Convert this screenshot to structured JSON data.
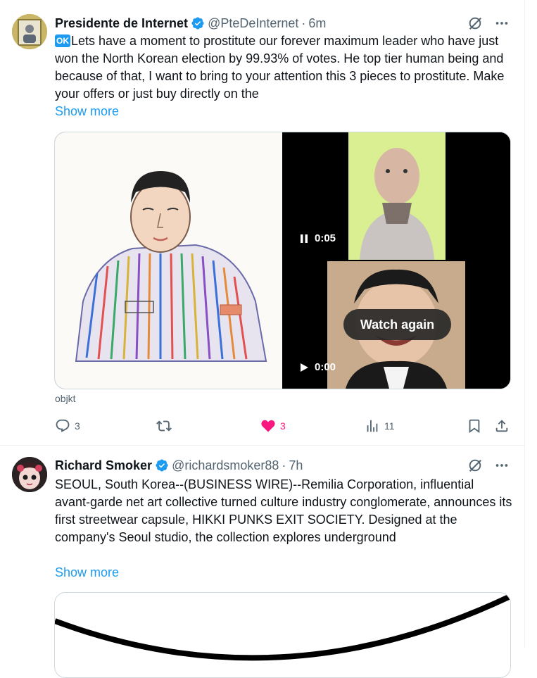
{
  "tweets": [
    {
      "display_name": "Presidente de Internet",
      "handle": "@PteDeInternet",
      "time": "6m",
      "ok_badge": "OK",
      "text": "Lets have a moment to prostitute our forever maximum leader who have just won the North Korean election by 99.93% of votes. He top tier human being and because of that, I want to bring to your attention this 3 pieces to prostitute. Make your offers or just buy directly on the",
      "show_more": "Show more",
      "media": {
        "video1_time": "0:05",
        "video2_time": "0:00",
        "watch_again": "Watch again"
      },
      "source": "objkt",
      "replies": "3",
      "likes": "3",
      "views": "11",
      "liked": true
    },
    {
      "display_name": "Richard Smoker",
      "handle": "@richardsmoker88",
      "time": "7h",
      "text": "SEOUL, South Korea--(BUSINESS WIRE)--Remilia Corporation, influential avant-garde net art collective turned culture industry conglomerate, announces its first streetwear capsule, HIKKI PUNKS EXIT SOCIETY. Designed at the company's Seoul studio, the collection explores underground",
      "show_more": "Show more"
    }
  ],
  "icons": {
    "verified": "verified-badge-icon",
    "grok": "grok-icon",
    "more": "more-icon",
    "reply": "reply-icon",
    "retweet": "retweet-icon",
    "like": "heart-icon",
    "views": "views-icon",
    "bookmark": "bookmark-icon",
    "share": "share-icon"
  },
  "colors": {
    "accent": "#1d9bf0",
    "like": "#f91880",
    "muted": "#536471"
  }
}
